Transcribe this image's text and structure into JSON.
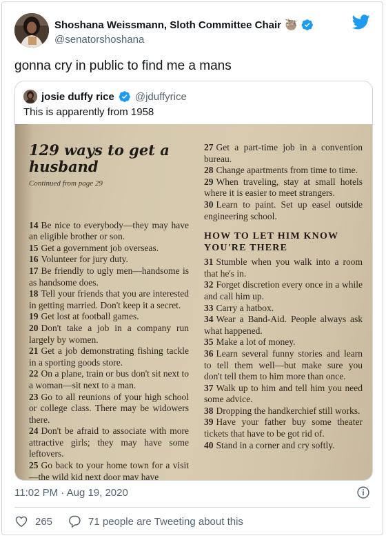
{
  "author": {
    "name": "Shoshana Weissmann, Sloth Committee Chair",
    "emoji": "🦥",
    "handle": "@senatorshoshana"
  },
  "tweet_text": "gonna cry in public to find me a mans",
  "quoted": {
    "name": "josie duffy rice",
    "handle": "@jduffyrice",
    "text": "This is apparently from 1958",
    "photo": {
      "title": "129 ways to get a husband",
      "subtitle": "Continued from page 29",
      "left_entries": [
        {
          "num": "14",
          "text": "Be nice to everybody—they may have an eligible brother or son."
        },
        {
          "num": "15",
          "text": "Get a government job overseas."
        },
        {
          "num": "16",
          "text": "Volunteer for jury duty."
        },
        {
          "num": "17",
          "text": "Be friendly to ugly men—handsome is as handsome does."
        },
        {
          "num": "18",
          "text": "Tell your friends that you are interested in getting married. Don't keep it a secret."
        },
        {
          "num": "19",
          "text": "Get lost at football games."
        },
        {
          "num": "20",
          "text": "Don't take a job in a company run largely by women."
        },
        {
          "num": "21",
          "text": "Get a job demonstrating fishing tackle in a sporting goods store."
        },
        {
          "num": "22",
          "text": "On a plane, train or bus don't sit next to a woman—sit next to a man."
        },
        {
          "num": "23",
          "text": "Go to all reunions of your high school or college class. There may be widowers there."
        },
        {
          "num": "24",
          "text": "Don't be afraid to associate with more attractive girls; they may have some leftovers."
        },
        {
          "num": "25",
          "text": "Go back to your home town for a visit—the wild kid next door may have"
        }
      ],
      "right_entries_top": [
        {
          "num": "27",
          "text": "Get a part-time job in a convention bureau."
        },
        {
          "num": "28",
          "text": "Change apartments from time to time."
        },
        {
          "num": "29",
          "text": "When traveling, stay at small hotels where it is easier to meet strangers."
        },
        {
          "num": "30",
          "text": "Learn to paint. Set up easel outside engineering school."
        }
      ],
      "section_heading": "HOW TO LET HIM KNOW YOU'RE THERE",
      "right_entries_bottom": [
        {
          "num": "31",
          "text": "Stumble when you walk into a room that he's in."
        },
        {
          "num": "32",
          "text": "Forget discretion every once in a while and call him up."
        },
        {
          "num": "33",
          "text": "Carry a hatbox."
        },
        {
          "num": "34",
          "text": "Wear a Band-Aid. People always ask what happened."
        },
        {
          "num": "35",
          "text": "Make a lot of money."
        },
        {
          "num": "36",
          "text": "Learn several funny stories and learn to tell them well—but make sure you don't tell them to him more than once."
        },
        {
          "num": "37",
          "text": "Walk up to him and tell him you need some advice."
        },
        {
          "num": "38",
          "text": "Dropping the handkerchief still works."
        },
        {
          "num": "39",
          "text": "Have your father buy some theater tickets that have to be got rid of."
        },
        {
          "num": "40",
          "text": "Stand in a corner and cry softly."
        }
      ]
    }
  },
  "timestamp": "11:02 PM · Aug 19, 2020",
  "likes": "265",
  "retweet_text": "71 people are Tweeting about this",
  "colors": {
    "twitter_blue": "#1d9bf0",
    "secondary_text": "#536471",
    "border": "#cfd9de"
  }
}
